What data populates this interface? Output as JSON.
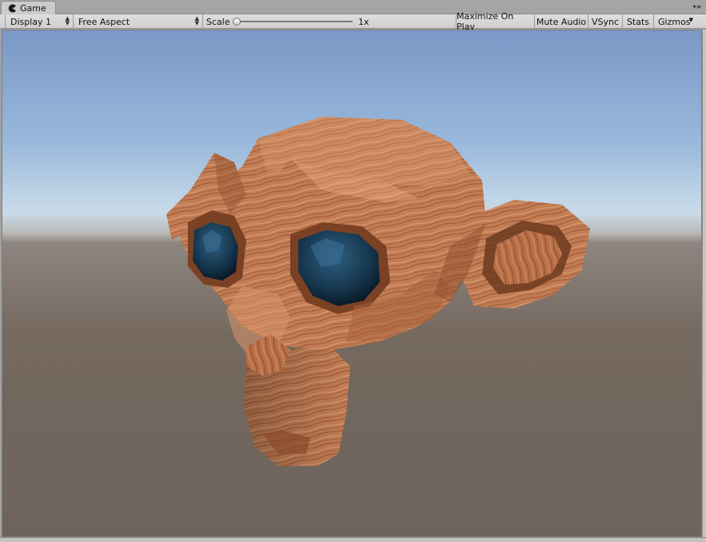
{
  "tab": {
    "label": "Game",
    "icon": "pacman-icon"
  },
  "toolbar": {
    "display": "Display 1",
    "aspect": "Free Aspect",
    "scale_label": "Scale",
    "scale_value": "1x",
    "scale_fraction": 0.0,
    "buttons": {
      "maximize": "Maximize On Play",
      "mute": "Mute Audio",
      "vsync": "VSync",
      "stats": "Stats",
      "gizmos": "Gizmos"
    }
  },
  "colors": {
    "eye": "#16384f",
    "wood": "#c07a52",
    "sky_top": "#7a98c6",
    "ground": "#6d645d"
  }
}
